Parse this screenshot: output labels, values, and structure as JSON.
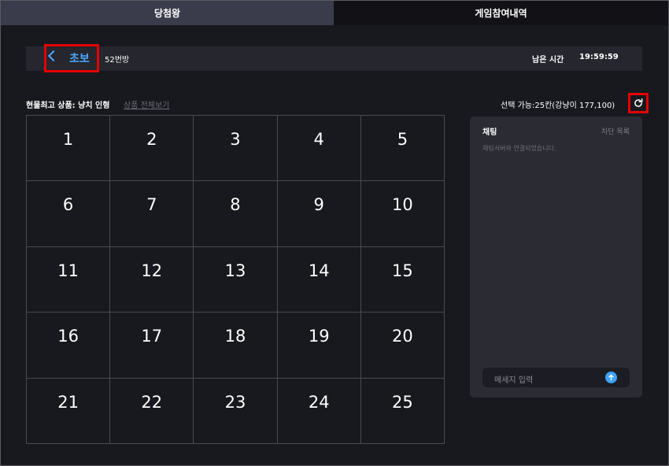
{
  "tabs": [
    {
      "label": "당첨왕"
    },
    {
      "label": "게임참여내역"
    }
  ],
  "header": {
    "back_label": "초보",
    "room": "52번방",
    "time_label": "남은 시간",
    "time_value": "19:59:59"
  },
  "prize": {
    "label": "현물최고 상품: 냥치 인형",
    "view_all": "상품 전체보기"
  },
  "availability": "선택 가능:25칸(강냥이 177,100)",
  "grid": {
    "cells": [
      "1",
      "2",
      "3",
      "4",
      "5",
      "6",
      "7",
      "8",
      "9",
      "10",
      "11",
      "12",
      "13",
      "14",
      "15",
      "16",
      "17",
      "18",
      "19",
      "20",
      "21",
      "22",
      "23",
      "24",
      "25"
    ]
  },
  "chat": {
    "title": "채팅",
    "block_list": "차단 목록",
    "message": "채팅서버와 연결되었습니다.",
    "input_placeholder": "메세지 입력"
  },
  "colors": {
    "accent": "#4aa9ff",
    "highlight": "#e50000",
    "background": "#18181f"
  },
  "icons": {
    "back": "chevron-left-icon",
    "refresh": "refresh-icon",
    "send": "arrow-up-icon"
  }
}
